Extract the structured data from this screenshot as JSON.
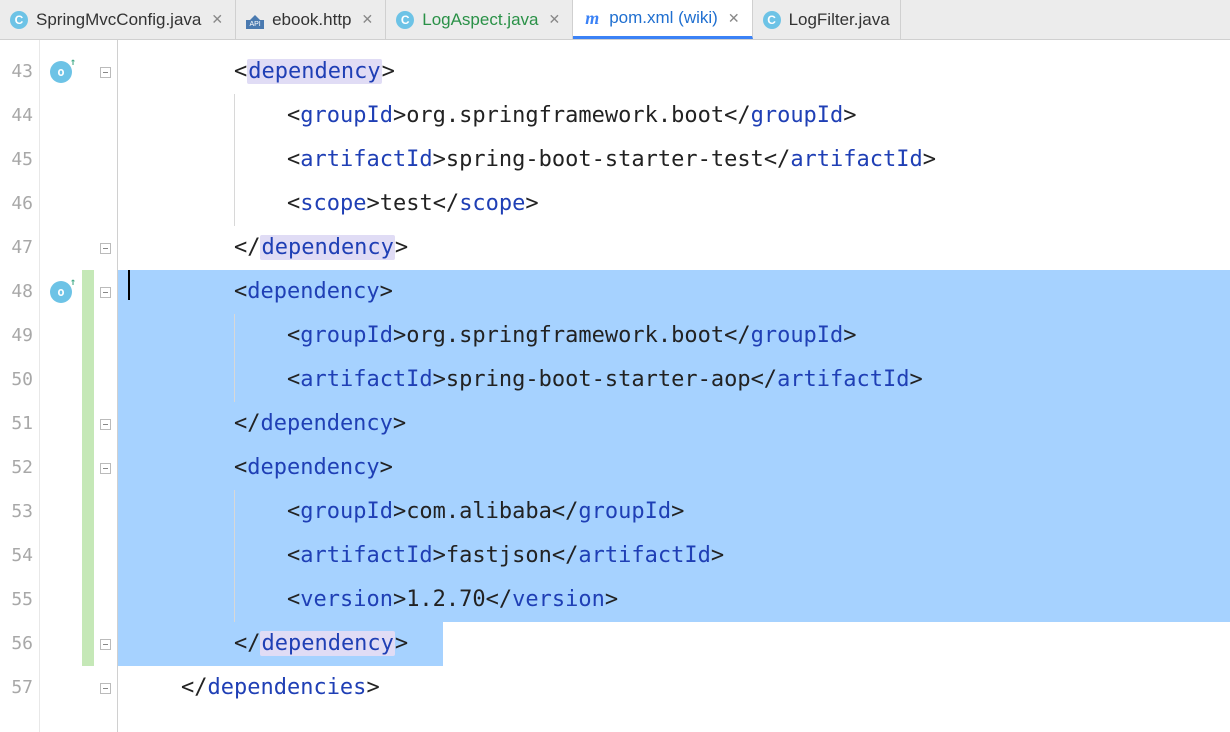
{
  "tabs": [
    {
      "icon": "c",
      "label": "SpringMvcConfig.java",
      "style": "plain",
      "active": false
    },
    {
      "icon": "api",
      "label": "ebook.http",
      "style": "plain",
      "active": false
    },
    {
      "icon": "c",
      "label": "LogAspect.java",
      "style": "green",
      "active": false
    },
    {
      "icon": "m",
      "label": "pom.xml (wiki)",
      "style": "blue",
      "active": true
    },
    {
      "icon": "c",
      "label": "LogFilter.java",
      "style": "plain",
      "active": false
    }
  ],
  "close_glyph": "✕",
  "lineNumbers": [
    "43",
    "44",
    "45",
    "46",
    "47",
    "48",
    "49",
    "50",
    "51",
    "52",
    "53",
    "54",
    "55",
    "56",
    "57"
  ],
  "code": {
    "l43": {
      "open": "<",
      "tag": "dependency",
      "close": ">"
    },
    "l44": {
      "open": "<",
      "tag": "groupId",
      "mid": ">",
      "txt": "org.springframework.boot",
      "copen": "</",
      "cclose": ">"
    },
    "l45": {
      "open": "<",
      "tag": "artifactId",
      "mid": ">",
      "txt": "spring-boot-starter-test",
      "copen": "</",
      "cclose": ">"
    },
    "l46": {
      "open": "<",
      "tag": "scope",
      "mid": ">",
      "txt": "test",
      "copen": "</",
      "cclose": ">"
    },
    "l47": {
      "open": "</",
      "tag": "dependency",
      "close": ">"
    },
    "l48": {
      "open": "<",
      "tag": "dependency",
      "close": ">"
    },
    "l49": {
      "open": "<",
      "tag": "groupId",
      "mid": ">",
      "txt": "org.springframework.boot",
      "copen": "</",
      "cclose": ">"
    },
    "l50": {
      "open": "<",
      "tag": "artifactId",
      "mid": ">",
      "txt": "spring-boot-starter-aop",
      "copen": "</",
      "cclose": ">"
    },
    "l51": {
      "open": "</",
      "tag": "dependency",
      "close": ">"
    },
    "l52": {
      "open": "<",
      "tag": "dependency",
      "close": ">"
    },
    "l53": {
      "open": "<",
      "tag": "groupId",
      "mid": ">",
      "txt": "com.alibaba",
      "copen": "</",
      "cclose": ">"
    },
    "l54": {
      "open": "<",
      "tag": "artifactId",
      "mid": ">",
      "txt": "fastjson",
      "copen": "</",
      "cclose": ">"
    },
    "l55": {
      "open": "<",
      "tag": "version",
      "mid": ">",
      "txt": "1.2.70",
      "copen": "</",
      "cclose": ">"
    },
    "l56": {
      "open": "</",
      "tag": "dependency",
      "close": ">"
    },
    "l57": {
      "open": "</",
      "tag": "dependencies",
      "close": ">"
    }
  }
}
